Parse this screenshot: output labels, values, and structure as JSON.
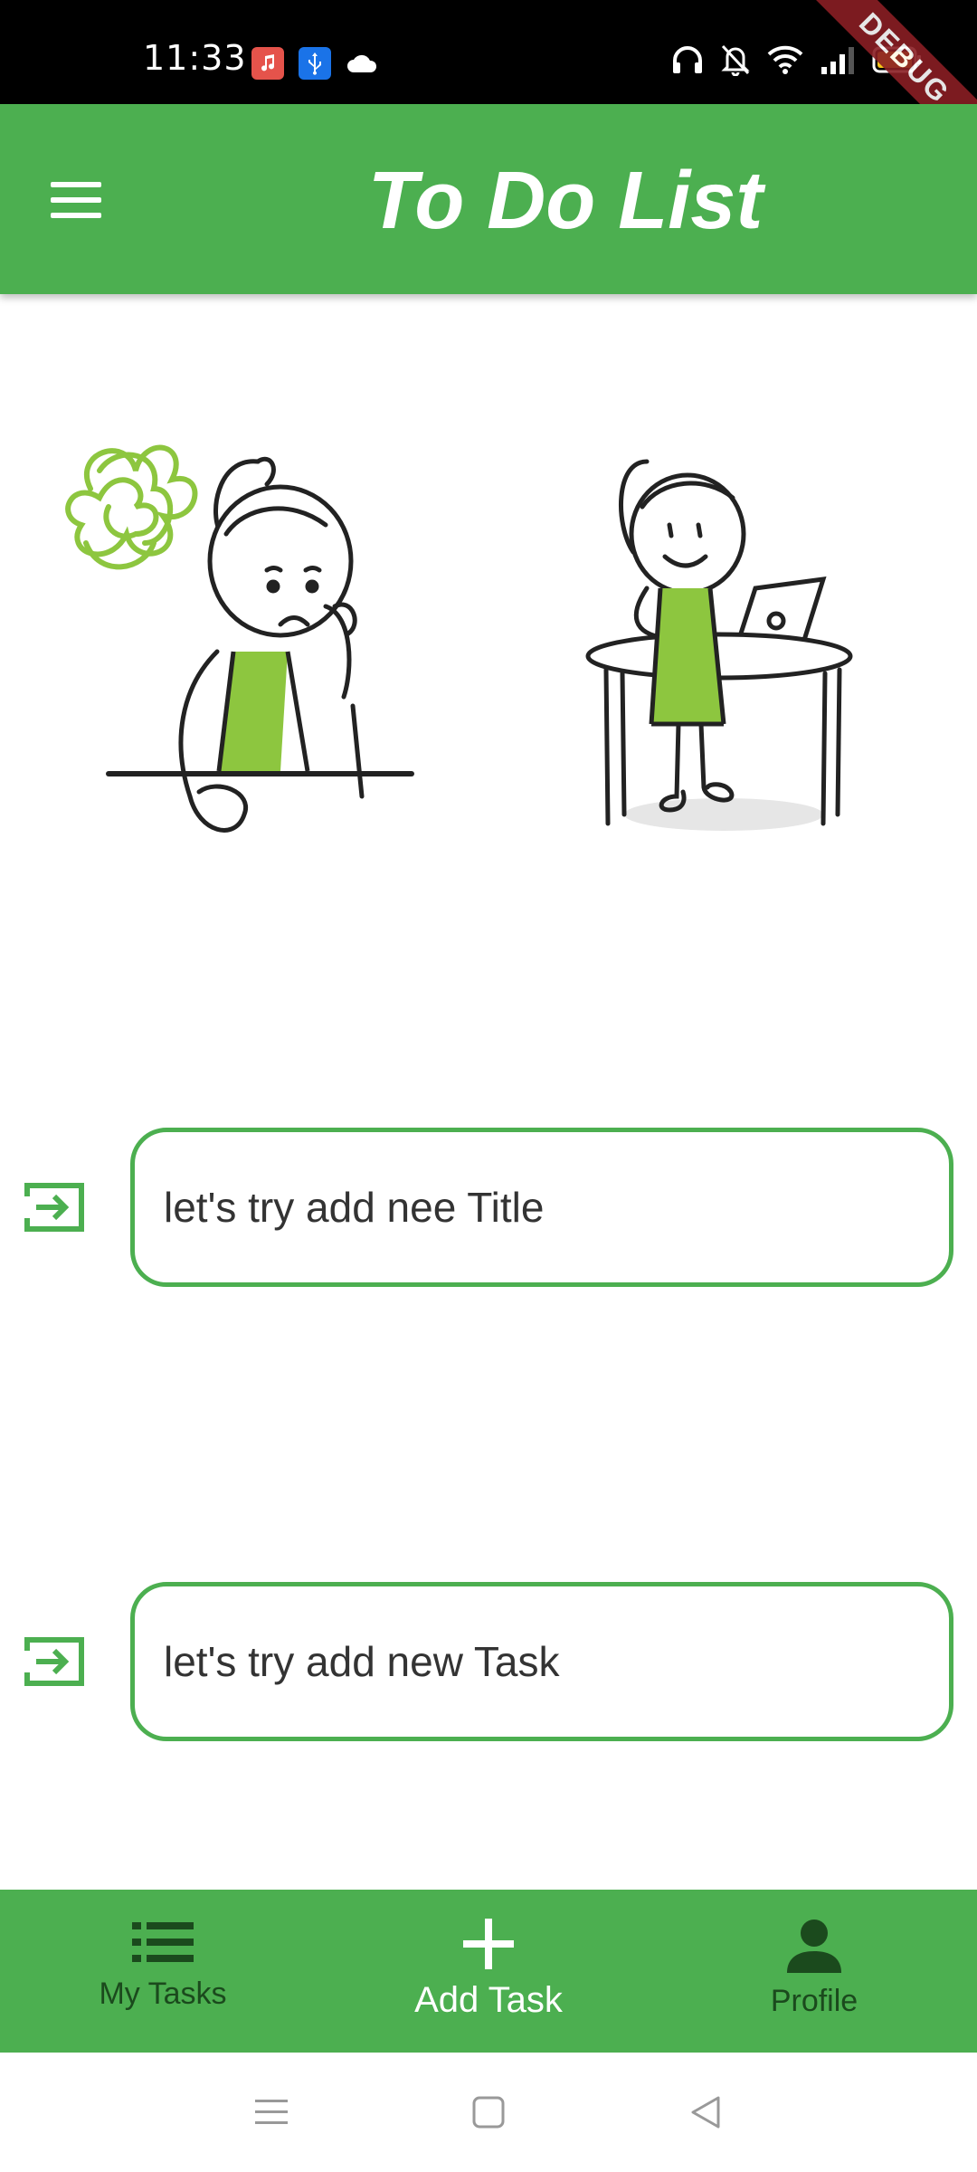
{
  "status_bar": {
    "time": "11:33",
    "debug_label": "DEBUG",
    "notif_icons": [
      "music-app-icon",
      "usb-icon",
      "cloud-icon"
    ],
    "right_icons": [
      "headphones-icon",
      "bell-off-icon",
      "wifi-icon",
      "signal-icon",
      "battery-icon"
    ]
  },
  "app_bar": {
    "title": "To Do List",
    "menu_icon": "hamburger-menu-icon"
  },
  "form": {
    "title_field": {
      "placeholder": "let's try add nee Title",
      "value": ""
    },
    "task_field": {
      "placeholder": "let's try add new Task",
      "value": ""
    }
  },
  "bottom_nav": {
    "items": [
      {
        "label": "My Tasks",
        "icon": "list-icon",
        "active": false
      },
      {
        "label": "Add Task",
        "icon": "plus-icon",
        "active": true
      },
      {
        "label": "Profile",
        "icon": "person-icon",
        "active": false
      }
    ]
  },
  "colors": {
    "primary": "#4caf50",
    "dark_label": "#1b4a1d",
    "illustration_accent": "#8dc63f"
  }
}
